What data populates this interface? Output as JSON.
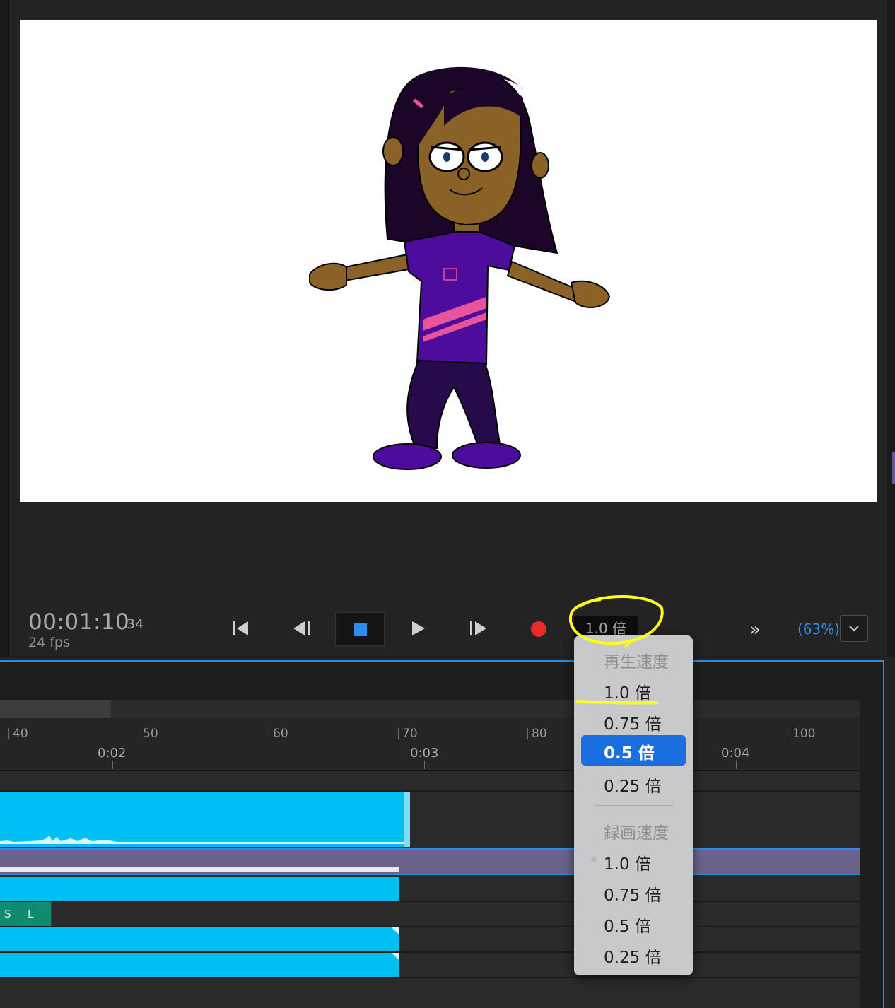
{
  "transport": {
    "timecode": "00:01:10",
    "frame": "34",
    "fps": "24 fps",
    "speed_value": "1.0 倍",
    "fast_forward": "»",
    "zoom": "(63%)"
  },
  "ruler": {
    "frame_ticks": [
      "40",
      "50",
      "60",
      "70",
      "80",
      "100"
    ],
    "time_ticks": [
      "0:02",
      "0:03",
      "0:04"
    ]
  },
  "tracks": {
    "tag_s": "S",
    "tag_l": "L"
  },
  "speed_menu": {
    "playback_header": "再生速度",
    "playback_options": [
      "1.0 倍",
      "0.75 倍",
      "0.5 倍",
      "0.25 倍"
    ],
    "playback_selected": "0.5 倍",
    "record_header": "録画速度",
    "record_options": [
      "1.0 倍",
      "0.75 倍",
      "0.5 倍",
      "0.25 倍"
    ]
  },
  "colors": {
    "accent_blue": "#2e8ef0",
    "record_red": "#e82c2c",
    "clip_cyan": "#00bff2",
    "highlight_yellow": "#ffff1a"
  },
  "icons": {
    "go_start": "skip-to-start-icon",
    "step_back": "step-back-icon",
    "stop": "stop-icon",
    "play": "play-icon",
    "step_forward": "step-forward-icon",
    "record": "record-icon",
    "zoom_menu": "chevron-down-icon"
  }
}
